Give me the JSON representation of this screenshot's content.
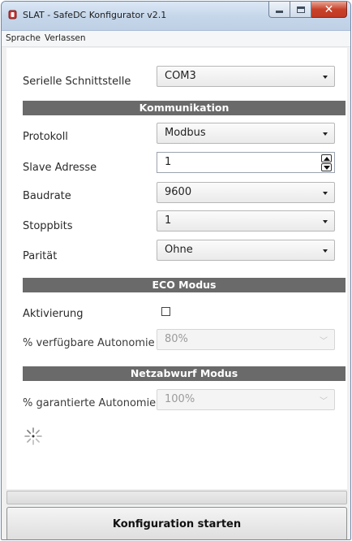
{
  "window": {
    "title": "SLAT - SafeDC Konfigurator v2.1"
  },
  "menu": {
    "items": [
      "Sprache",
      "Verlassen"
    ]
  },
  "serial": {
    "label": "Serielle Schnittstelle",
    "value": "COM3"
  },
  "sections": {
    "communication": "Kommunikation",
    "eco": "ECO Modus",
    "load_shedding": "Netzabwurf Modus"
  },
  "communication": {
    "protocol": {
      "label": "Protokoll",
      "value": "Modbus"
    },
    "slave": {
      "label": "Slave Adresse",
      "value": "1"
    },
    "baud": {
      "label": "Baudrate",
      "value": "9600"
    },
    "stopbits": {
      "label": "Stoppbits",
      "value": "1"
    },
    "parity": {
      "label": "Parität",
      "value": "Ohne"
    }
  },
  "eco": {
    "activation": {
      "label": "Aktivierung",
      "checked": false
    },
    "autonomy": {
      "label": "% verfügbare Autonomie",
      "value": "80%"
    }
  },
  "load_shedding": {
    "autonomy": {
      "label": "% garantierte Autonomie",
      "value": "100%"
    }
  },
  "progress": {
    "percent": 0
  },
  "action": {
    "start_label": "Konfiguration starten"
  },
  "icons": {
    "app": "app-icon",
    "spinner": "loading-spinner-icon"
  }
}
